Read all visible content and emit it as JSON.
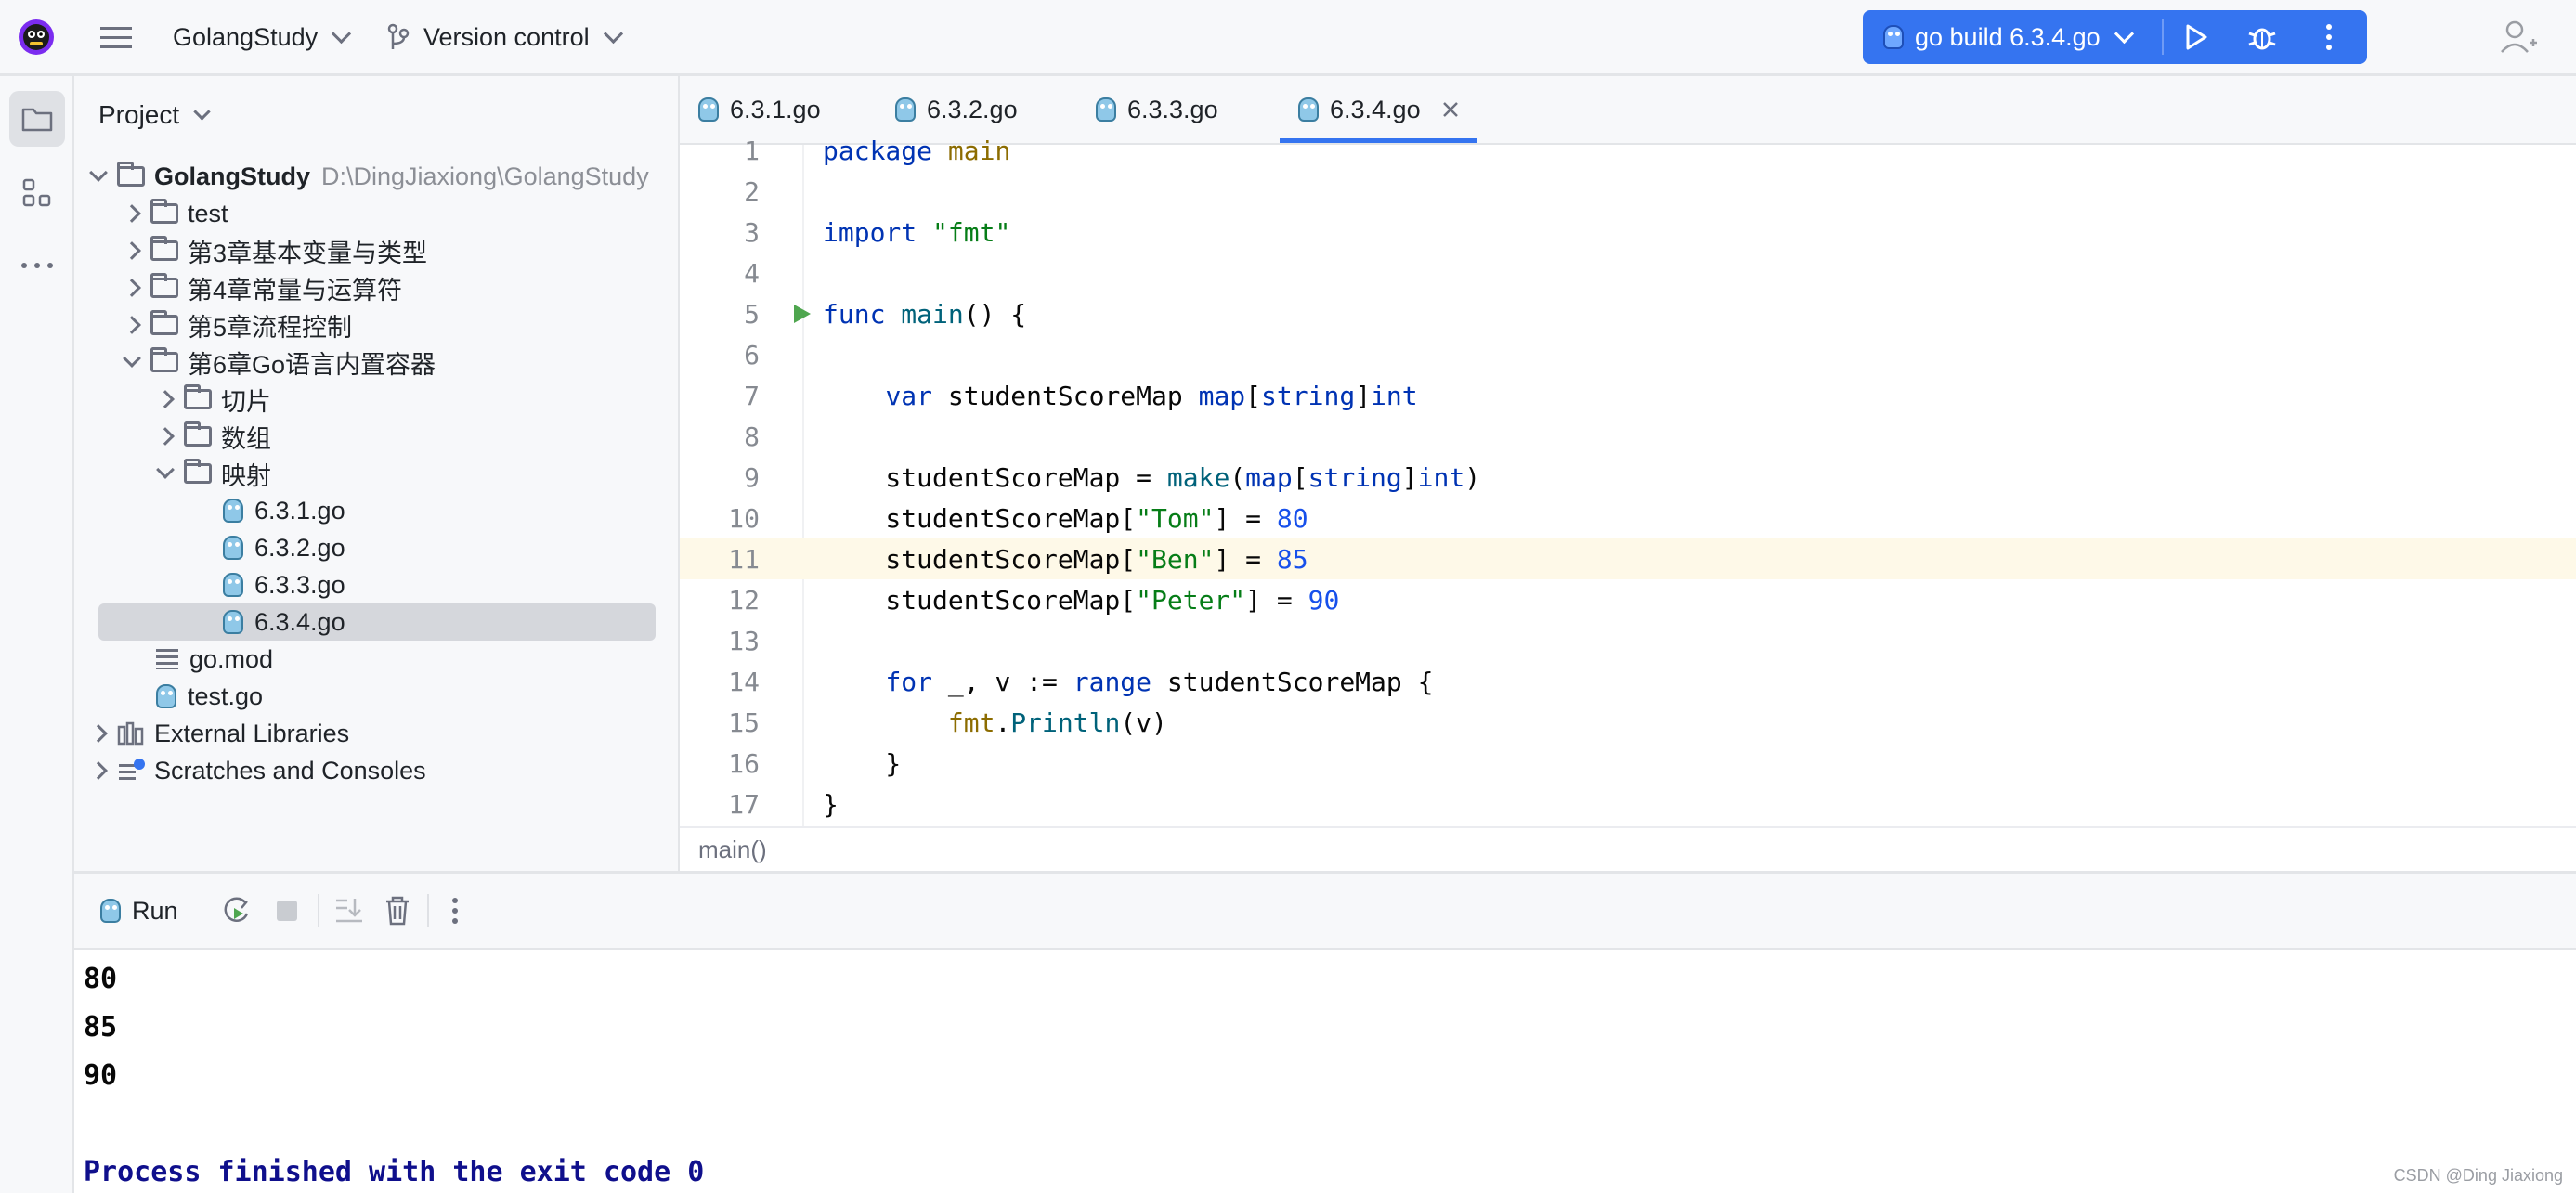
{
  "titlebar": {
    "project_name": "GolangStudy",
    "vcs_label": "Version control",
    "run_config": "go build 6.3.4.go"
  },
  "project_panel": {
    "title": "Project",
    "tree": [
      {
        "label": "GolangStudy",
        "hint": "D:\\DingJiaxiong\\GolangStudy"
      },
      {
        "label": "test"
      },
      {
        "label": "第3章基本变量与类型"
      },
      {
        "label": "第4章常量与运算符"
      },
      {
        "label": "第5章流程控制"
      },
      {
        "label": "第6章Go语言内置容器"
      },
      {
        "label": "切片"
      },
      {
        "label": "数组"
      },
      {
        "label": "映射"
      },
      {
        "label": "6.3.1.go"
      },
      {
        "label": "6.3.2.go"
      },
      {
        "label": "6.3.3.go"
      },
      {
        "label": "6.3.4.go"
      },
      {
        "label": "go.mod"
      },
      {
        "label": "test.go"
      },
      {
        "label": "External Libraries"
      },
      {
        "label": "Scratches and Consoles"
      }
    ]
  },
  "tabs": [
    "6.3.1.go",
    "6.3.2.go",
    "6.3.3.go",
    "6.3.4.go"
  ],
  "editor": {
    "line_numbers": [
      "1",
      "2",
      "3",
      "4",
      "5",
      "6",
      "7",
      "8",
      "9",
      "10",
      "11",
      "12",
      "13",
      "14",
      "15",
      "16",
      "17"
    ],
    "breadcrumb": "main()"
  },
  "run_panel": {
    "title": "Run",
    "output": [
      "80",
      "85",
      "90",
      "",
      "Process finished with the exit code 0"
    ]
  },
  "watermark": "CSDN @Ding Jiaxiong",
  "colors": {
    "accent": "#3574f0",
    "keyword": "#0033b3",
    "string": "#067d17",
    "number": "#1750eb"
  }
}
